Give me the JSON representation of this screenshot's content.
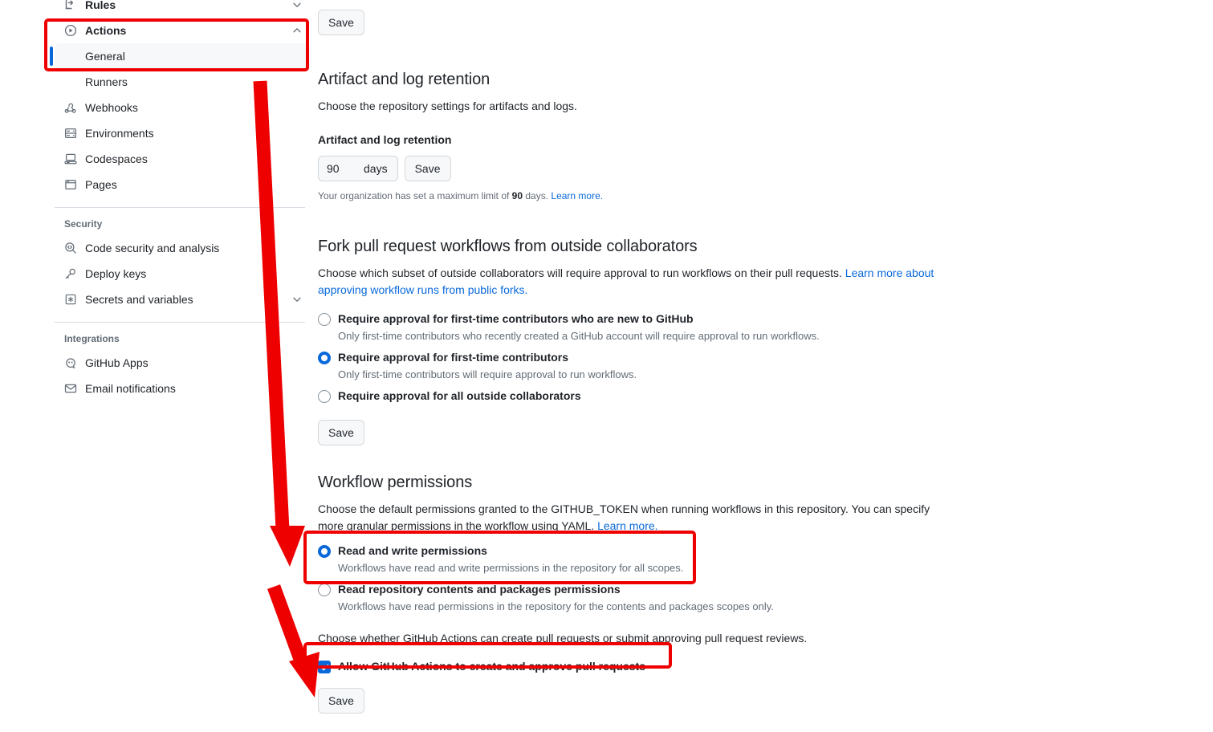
{
  "sidebar": {
    "items": [
      {
        "label": "Rules",
        "icon": "rules-icon",
        "expandable": true,
        "state": "collapsed"
      },
      {
        "label": "Actions",
        "icon": "play-circle-icon",
        "expandable": true,
        "state": "expanded"
      }
    ],
    "actions_children": [
      {
        "label": "General",
        "active": true
      },
      {
        "label": "Runners",
        "active": false
      }
    ],
    "middle_items": [
      {
        "label": "Webhooks",
        "icon": "webhook-icon"
      },
      {
        "label": "Environments",
        "icon": "server-icon"
      },
      {
        "label": "Codespaces",
        "icon": "codespaces-icon"
      },
      {
        "label": "Pages",
        "icon": "browser-icon"
      }
    ],
    "security_group": {
      "title": "Security",
      "items": [
        {
          "label": "Code security and analysis",
          "icon": "codescan-icon",
          "expandable": false
        },
        {
          "label": "Deploy keys",
          "icon": "key-icon",
          "expandable": false
        },
        {
          "label": "Secrets and variables",
          "icon": "asterisk-key-icon",
          "expandable": true
        }
      ]
    },
    "integrations_group": {
      "title": "Integrations",
      "items": [
        {
          "label": "GitHub Apps",
          "icon": "apps-icon"
        },
        {
          "label": "Email notifications",
          "icon": "mail-icon"
        }
      ]
    }
  },
  "main": {
    "top_save_label": "Save",
    "artifact": {
      "title": "Artifact and log retention",
      "description": "Choose the repository settings for artifacts and logs.",
      "field_label": "Artifact and log retention",
      "value": "90",
      "unit": "days",
      "save_label": "Save",
      "hint_prefix": "Your organization has set a maximum limit of ",
      "hint_value": "90",
      "hint_suffix": " days. ",
      "hint_link": "Learn more."
    },
    "fork": {
      "title": "Fork pull request workflows from outside collaborators",
      "description_part1": "Choose which subset of outside collaborators will require approval to run workflows on their pull requests. ",
      "description_link": "Learn more about approving workflow runs from public forks.",
      "options": [
        {
          "label": "Require approval for first-time contributors who are new to GitHub",
          "sub": "Only first-time contributors who recently created a GitHub account will require approval to run workflows.",
          "checked": false
        },
        {
          "label": "Require approval for first-time contributors",
          "sub": "Only first-time contributors will require approval to run workflows.",
          "checked": true
        },
        {
          "label": "Require approval for all outside collaborators",
          "sub": "",
          "checked": false
        }
      ],
      "save_label": "Save"
    },
    "workflow_permissions": {
      "title": "Workflow permissions",
      "description_part1": "Choose the default permissions granted to the GITHUB_TOKEN when running workflows in this repository. You can specify more granular permissions in the workflow using YAML. ",
      "description_link": "Learn more.",
      "options": [
        {
          "label": "Read and write permissions",
          "sub": "Workflows have read and write permissions in the repository for all scopes.",
          "checked": true
        },
        {
          "label": "Read repository contents and packages permissions",
          "sub": "Workflows have read permissions in the repository for the contents and packages scopes only.",
          "checked": false
        }
      ],
      "pr_description": "Choose whether GitHub Actions can create pull requests or submit approving pull request reviews.",
      "pr_checkbox_label": "Allow GitHub Actions to create and approve pull requests",
      "pr_checkbox_checked": true,
      "save_label": "Save"
    }
  },
  "annotations": {
    "highlight_color": "#ee0000",
    "boxes": [
      {
        "name": "sidebar-actions-general-highlight"
      },
      {
        "name": "read-and-write-permissions-highlight"
      },
      {
        "name": "allow-create-approve-pr-highlight"
      }
    ],
    "arrows": [
      {
        "name": "arrow-to-read-and-write-permissions"
      },
      {
        "name": "arrow-to-save-button"
      }
    ]
  },
  "colors": {
    "accent_blue": "#0969da",
    "annotation_red": "#ee0000",
    "muted_text": "#636c76",
    "body_text": "#1f2328",
    "selected_bg": "#f6f8fa"
  }
}
